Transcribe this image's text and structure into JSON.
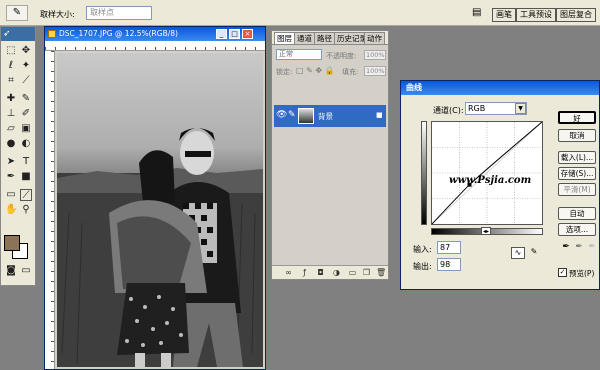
{
  "options_bar": {
    "sample_size_label": "取样大小:",
    "sample_size_value": "取样点",
    "palette_tabs": [
      "画笔",
      "工具预设",
      "图层复合"
    ]
  },
  "toolbox": {
    "foreground_color": "#8b7358",
    "background_color": "#ffffff",
    "tools": [
      "marquee-icon",
      "move-icon",
      "lasso-icon",
      "magic-wand-icon",
      "crop-icon",
      "slice-icon",
      "healing-icon",
      "brush-icon",
      "stamp-icon",
      "history-brush-icon",
      "eraser-icon",
      "gradient-icon",
      "blur-icon",
      "dodge-icon",
      "path-select-icon",
      "type-icon",
      "pen-icon",
      "shape-icon",
      "notes-icon",
      "eyedropper-icon",
      "hand-icon",
      "zoom-icon"
    ]
  },
  "document": {
    "title": "DSC_1707.JPG @ 12.5%(RGB/8)"
  },
  "layers_panel": {
    "tabs": [
      "图层",
      "通道",
      "路径",
      "历史记录",
      "动作"
    ],
    "blend_mode": "正常",
    "opacity_label": "不透明度:",
    "opacity_value": "100%",
    "lock_label": "锁定:",
    "fill_label": "填充:",
    "fill_value": "100%",
    "layer_name": "背景"
  },
  "curves_dialog": {
    "title": "曲线",
    "channel_label": "通道(C):",
    "channel_value": "RGB",
    "input_label": "输入:",
    "input_value": "87",
    "output_label": "输出:",
    "output_value": "98",
    "buttons": {
      "ok": "好",
      "cancel": "取消",
      "load": "载入(L)...",
      "save": "存储(S)...",
      "smooth": "平滑(M)",
      "auto": "自动",
      "options": "选项..."
    },
    "preview_label": "预览(P)",
    "preview_checked": true,
    "watermark": "www.Psjia.com"
  },
  "colors": {
    "titlebar": "#0a57d8",
    "selection": "#316ac5",
    "dialog_bg": "#ece9d8"
  }
}
